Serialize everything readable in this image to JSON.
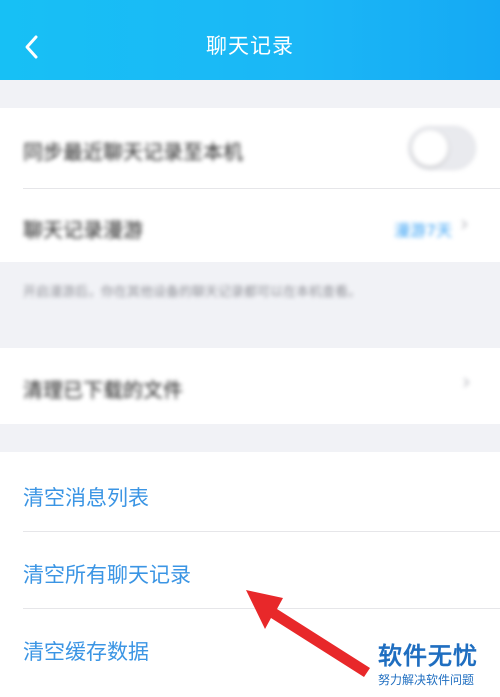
{
  "header": {
    "title": "聊天记录",
    "back_icon": "chevron-left-icon"
  },
  "settings": {
    "sync_label": "同步最近聊天记录至本机",
    "roaming_label": "聊天记录漫游",
    "roaming_value": "漫游7天",
    "note": "开启漫游后，你在其他设备的聊天记录都可以在本机查看。",
    "clean_downloads_label": "清理已下载的文件"
  },
  "actions": [
    {
      "label": "清空消息列表"
    },
    {
      "label": "清空所有聊天记录"
    },
    {
      "label": "清空缓存数据"
    }
  ],
  "watermark": {
    "title": "软件无忧",
    "subtitle": "努力解决软件问题"
  },
  "colors": {
    "header": "#17c0f5",
    "accent": "#3b95e4",
    "annotation_arrow": "#e8282a"
  }
}
